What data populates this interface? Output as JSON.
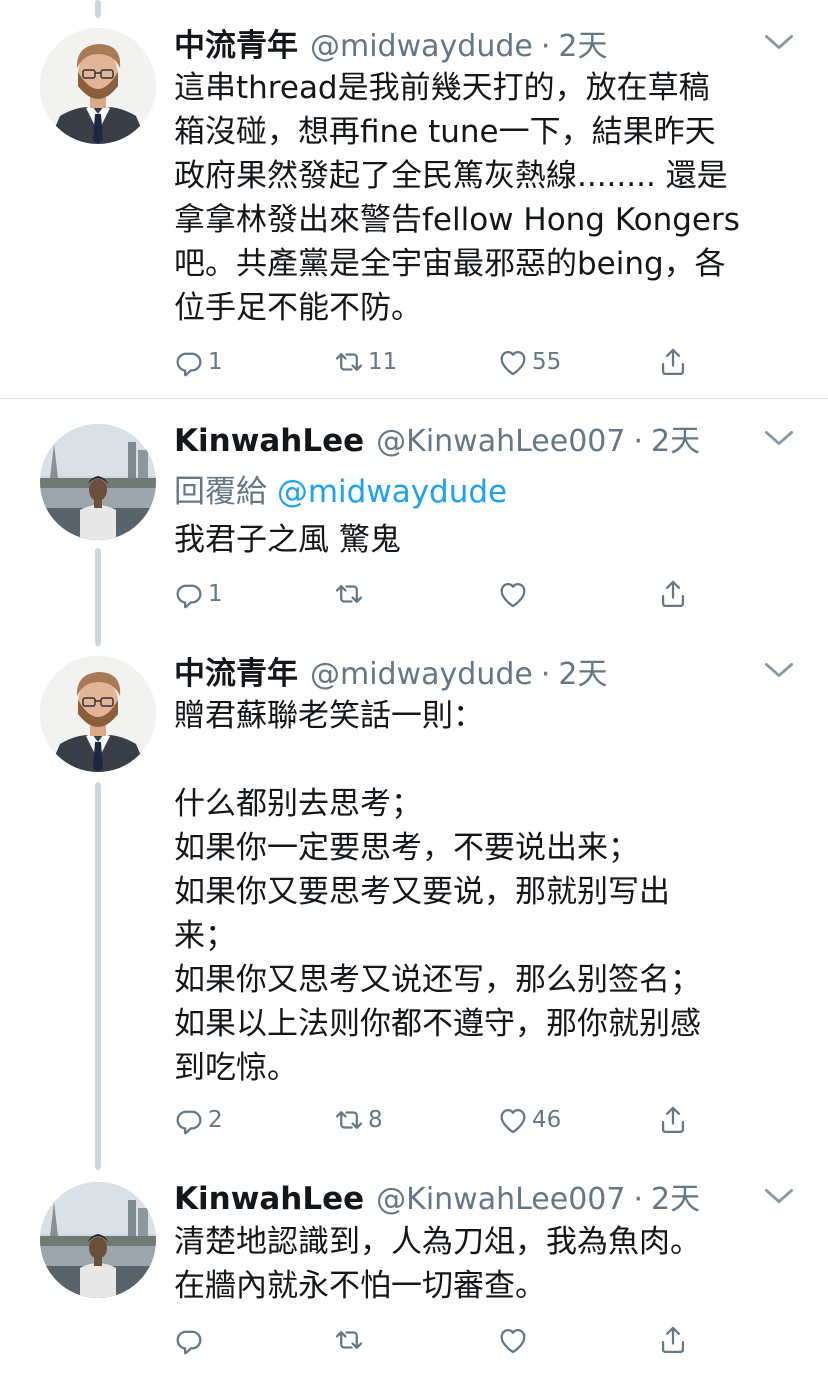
{
  "tweets": [
    {
      "name": "中流青年",
      "handle": "@midwaydude",
      "separator": "·",
      "time": "2天",
      "text": "這串thread是我前幾天打的，放在草稿\n箱沒碰，想再fine tune一下，結果昨天\n政府果然發起了全民篤灰熱線........ 還是\n拿拿林發出來警告fellow Hong Kongers\n吧。共產黨是全宇宙最邪惡的being，各\n位手足不能不防。",
      "replies": "1",
      "retweets": "11",
      "likes": "55"
    },
    {
      "name": "KinwahLee",
      "handle": "@KinwahLee007",
      "separator": "·",
      "time": "2天",
      "reply_prefix": "回覆給",
      "reply_to": "@midwaydude",
      "text": "我君子之風 驚鬼",
      "replies": "1",
      "retweets": "",
      "likes": ""
    },
    {
      "name": "中流青年",
      "handle": "@midwaydude",
      "separator": "·",
      "time": "2天",
      "text": "贈君蘇聯老笑話一則：\n\n什么都别去思考；\n如果你一定要思考，不要说出来；\n如果你又要思考又要说，那就别写出\n来；\n如果你又思考又说还写，那么别签名；\n如果以上法则你都不遵守，那你就别感\n到吃惊。",
      "replies": "2",
      "retweets": "8",
      "likes": "46"
    },
    {
      "name": "KinwahLee",
      "handle": "@KinwahLee007",
      "separator": "·",
      "time": "2天",
      "text": "清楚地認識到，人為刀俎，我為魚肉。\n在牆內就永不怕一切審查。",
      "replies": "",
      "retweets": "",
      "likes": ""
    }
  ],
  "icons": {
    "reply": "reply-icon",
    "retweet": "retweet-icon",
    "like": "heart-icon",
    "share": "share-icon",
    "menu": "chevron-down-icon"
  },
  "colors": {
    "text": "#14171a",
    "muted": "#657786",
    "link": "#1da1f2",
    "thread_line": "#ccd6dd",
    "divider": "#e1e8ed"
  }
}
